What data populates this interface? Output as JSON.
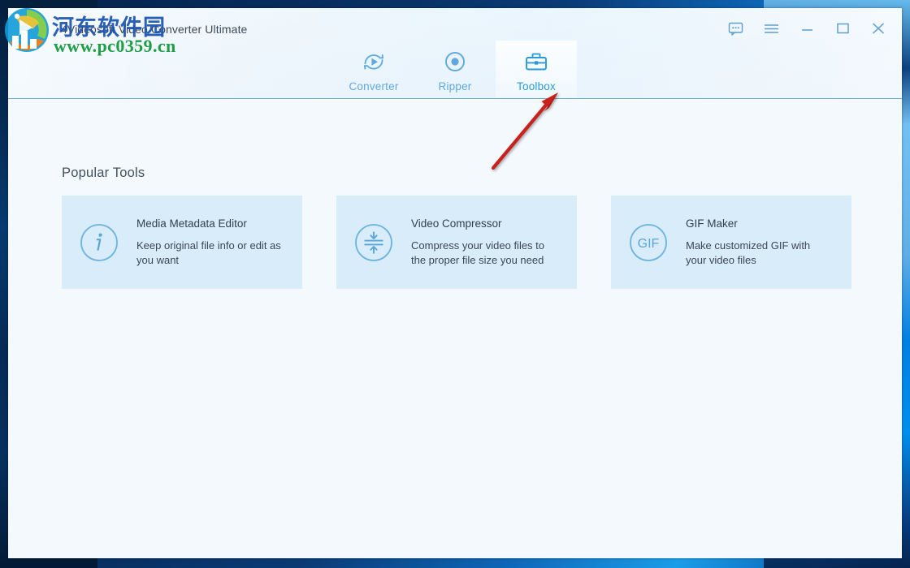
{
  "window": {
    "title": "4Videosoft Video Converter Ultimate",
    "controls": [
      {
        "name": "feedback-icon",
        "label": "Feedback"
      },
      {
        "name": "menu-icon",
        "label": "Menu"
      },
      {
        "name": "minimize-icon",
        "label": "Minimize"
      },
      {
        "name": "maximize-icon",
        "label": "Maximize"
      },
      {
        "name": "close-icon",
        "label": "Close"
      }
    ]
  },
  "watermark": {
    "chinese": "河东软件园",
    "url": "www.pc0359.cn",
    "logo_icon": "site-logo-icon"
  },
  "tabs": [
    {
      "label": "Converter",
      "icon": "convert-icon",
      "active": false
    },
    {
      "label": "Ripper",
      "icon": "disc-icon",
      "active": false
    },
    {
      "label": "Toolbox",
      "icon": "toolbox-icon",
      "active": true
    }
  ],
  "main": {
    "section_title": "Popular Tools",
    "cards": [
      {
        "title": "Media Metadata Editor",
        "description": "Keep original file info or edit as you want",
        "icon": "info-icon",
        "icon_text": ""
      },
      {
        "title": "Video Compressor",
        "description": "Compress your video files to the proper file size you need",
        "icon": "compress-icon",
        "icon_text": ""
      },
      {
        "title": "GIF Maker",
        "description": "Make customized GIF with your video files",
        "icon": "gif-icon",
        "icon_text": "GIF"
      }
    ]
  },
  "annotation": {
    "type": "red-arrow",
    "points_to": "Toolbox",
    "color": "#c8201f"
  },
  "colors": {
    "accent": "#2a9bd8",
    "tab_inactive": "#5fa9dd",
    "card_bg": "#d8ecfa",
    "header_bg": "#eaf4fc",
    "content_bg": "#f4f9fd",
    "rule": "#6ba9c4",
    "annotation_red": "#c8201f",
    "watermark_blue": "#1a53b0",
    "watermark_green": "#1f9e46"
  }
}
